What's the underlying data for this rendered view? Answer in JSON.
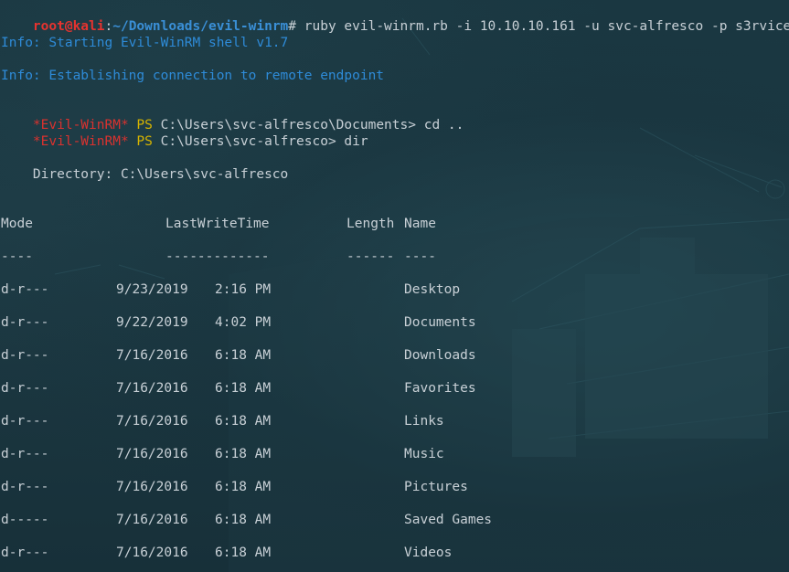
{
  "prompt": {
    "user_host": "root@kali",
    "separator": ":",
    "cwd": "~/Downloads/evil-winrm",
    "symbol": "#",
    "command": " ruby evil-winrm.rb -i 10.10.10.161 -u svc-alfresco -p s3rvice"
  },
  "info": [
    "Info: Starting Evil-WinRM shell v1.7",
    "Info: Establishing connection to remote endpoint"
  ],
  "ps_lines": [
    {
      "tag": "*Evil-WinRM*",
      "ps": "PS",
      "path": "C:\\Users\\svc-alfresco\\Documents>",
      "cmd": " cd .."
    },
    {
      "tag": "*Evil-WinRM*",
      "ps": "PS",
      "path": "C:\\Users\\svc-alfresco>",
      "cmd": " dir"
    }
  ],
  "directory_line": "    Directory: C:\\Users\\svc-alfresco",
  "table": {
    "headers": {
      "mode": "Mode",
      "last_write_time": "LastWriteTime",
      "length": "Length",
      "name": "Name"
    },
    "dividers": {
      "mode": "----",
      "last_write_time": "-------------",
      "length": "------",
      "name": "----"
    },
    "rows": [
      {
        "mode": "d-r---",
        "date": "9/23/2019",
        "time": "2:16 PM",
        "name": "Desktop"
      },
      {
        "mode": "d-r---",
        "date": "9/22/2019",
        "time": "4:02 PM",
        "name": "Documents"
      },
      {
        "mode": "d-r---",
        "date": "7/16/2016",
        "time": "6:18 AM",
        "name": "Downloads"
      },
      {
        "mode": "d-r---",
        "date": "7/16/2016",
        "time": "6:18 AM",
        "name": "Favorites"
      },
      {
        "mode": "d-r---",
        "date": "7/16/2016",
        "time": "6:18 AM",
        "name": "Links"
      },
      {
        "mode": "d-r---",
        "date": "7/16/2016",
        "time": "6:18 AM",
        "name": "Music"
      },
      {
        "mode": "d-r---",
        "date": "7/16/2016",
        "time": "6:18 AM",
        "name": "Pictures"
      },
      {
        "mode": "d-----",
        "date": "7/16/2016",
        "time": "6:18 AM",
        "name": "Saved Games"
      },
      {
        "mode": "d-r---",
        "date": "7/16/2016",
        "time": "6:18 AM",
        "name": "Videos"
      }
    ]
  },
  "colors": {
    "background": "#1b3640",
    "prompt_user": "#e5332f",
    "prompt_path": "#3a8fd6",
    "info_text": "#2e8bd8",
    "evil_tag": "#d9322f",
    "ps_label": "#d6b400",
    "text": "#c8d0d6"
  }
}
